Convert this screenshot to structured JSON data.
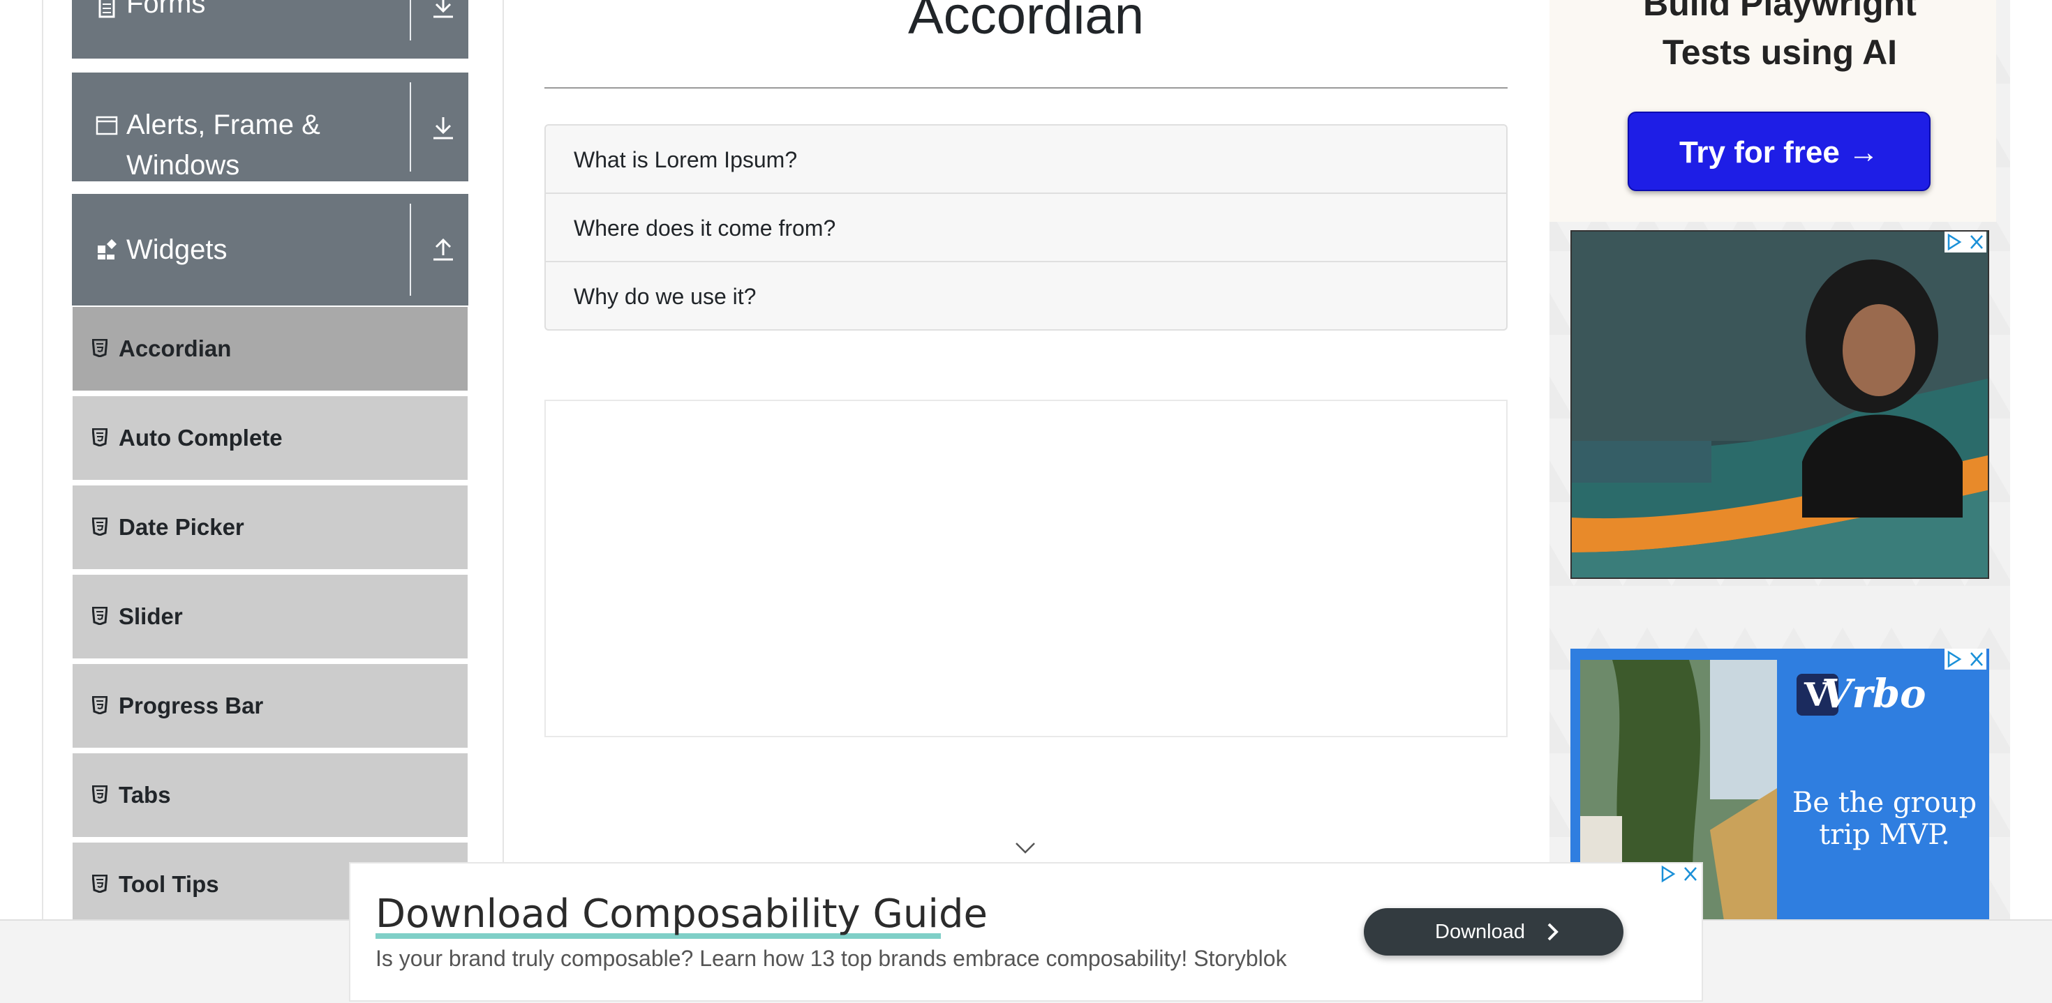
{
  "sidebar": {
    "groups": [
      {
        "label": "Forms",
        "icon": "document-icon",
        "state": "collapsed"
      },
      {
        "label_line1": "Alerts, Frame &",
        "label_line2": "Windows",
        "icon": "window-icon",
        "state": "collapsed"
      },
      {
        "label": "Widgets",
        "icon": "widgets-icon",
        "state": "expanded"
      }
    ],
    "items": [
      {
        "label": "Accordian",
        "active": true
      },
      {
        "label": "Auto Complete"
      },
      {
        "label": "Date Picker"
      },
      {
        "label": "Slider"
      },
      {
        "label": "Progress Bar"
      },
      {
        "label": "Tabs"
      },
      {
        "label": "Tool Tips"
      }
    ]
  },
  "main": {
    "title": "Accordian",
    "accordion": [
      {
        "label": "What is Lorem Ipsum?"
      },
      {
        "label": "Where does it come from?"
      },
      {
        "label": "Why do we use it?"
      }
    ]
  },
  "ads": {
    "playwright": {
      "heading_line1": "Build Playwright",
      "heading_line2": "Tests using AI",
      "button": "Try for free →"
    },
    "vrbo": {
      "logo": "Vrbo",
      "text_line1": "Be the group",
      "text_line2": "trip MVP."
    },
    "banner": {
      "title": "Download Composability Guide",
      "subtitle": "Is your brand truly composable? Learn how 13 top brands embrace composability! Storyblok",
      "button": "Download"
    }
  },
  "colors": {
    "sidebar_group": "#6c757d",
    "sidebar_item": "#cccccc",
    "sidebar_item_active": "#a9a9a9",
    "cta_blue": "#1e1ee6",
    "vrbo_blue": "#2f7ee0",
    "banner_button": "#333b40"
  }
}
